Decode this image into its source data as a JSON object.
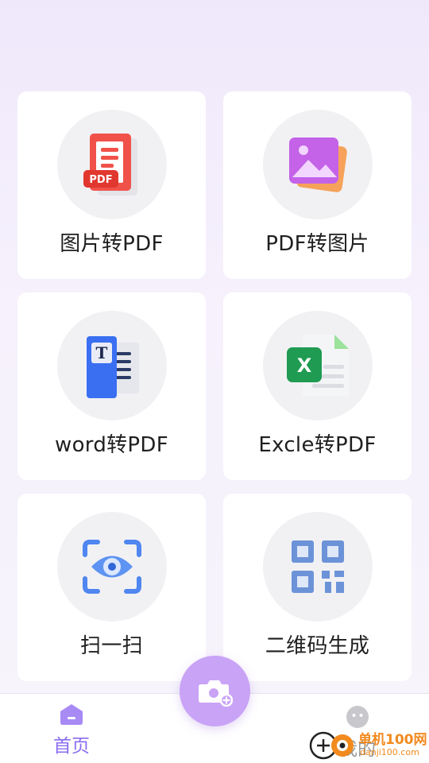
{
  "tools": [
    {
      "id": "img-to-pdf",
      "label": "图片转PDF",
      "icon": "pdf-document-icon"
    },
    {
      "id": "pdf-to-img",
      "label": "PDF转图片",
      "icon": "image-icon"
    },
    {
      "id": "word-to-pdf",
      "label": "word转PDF",
      "icon": "word-document-icon"
    },
    {
      "id": "excel-to-pdf",
      "label": "Excle转PDF",
      "icon": "excel-document-icon"
    },
    {
      "id": "scan",
      "label": "扫一扫",
      "icon": "scan-eye-icon"
    },
    {
      "id": "qr-gen",
      "label": "二维码生成",
      "icon": "qr-code-icon"
    }
  ],
  "nav": {
    "home_label": "首页",
    "mine_label": "我的",
    "camera_icon": "camera-add-icon"
  },
  "watermark": {
    "site": "单机100网",
    "url": "danji100.com"
  },
  "colors": {
    "accent": "#8a6cf0",
    "fab": "#c9a3f6",
    "background_top": "#efe8fb"
  }
}
